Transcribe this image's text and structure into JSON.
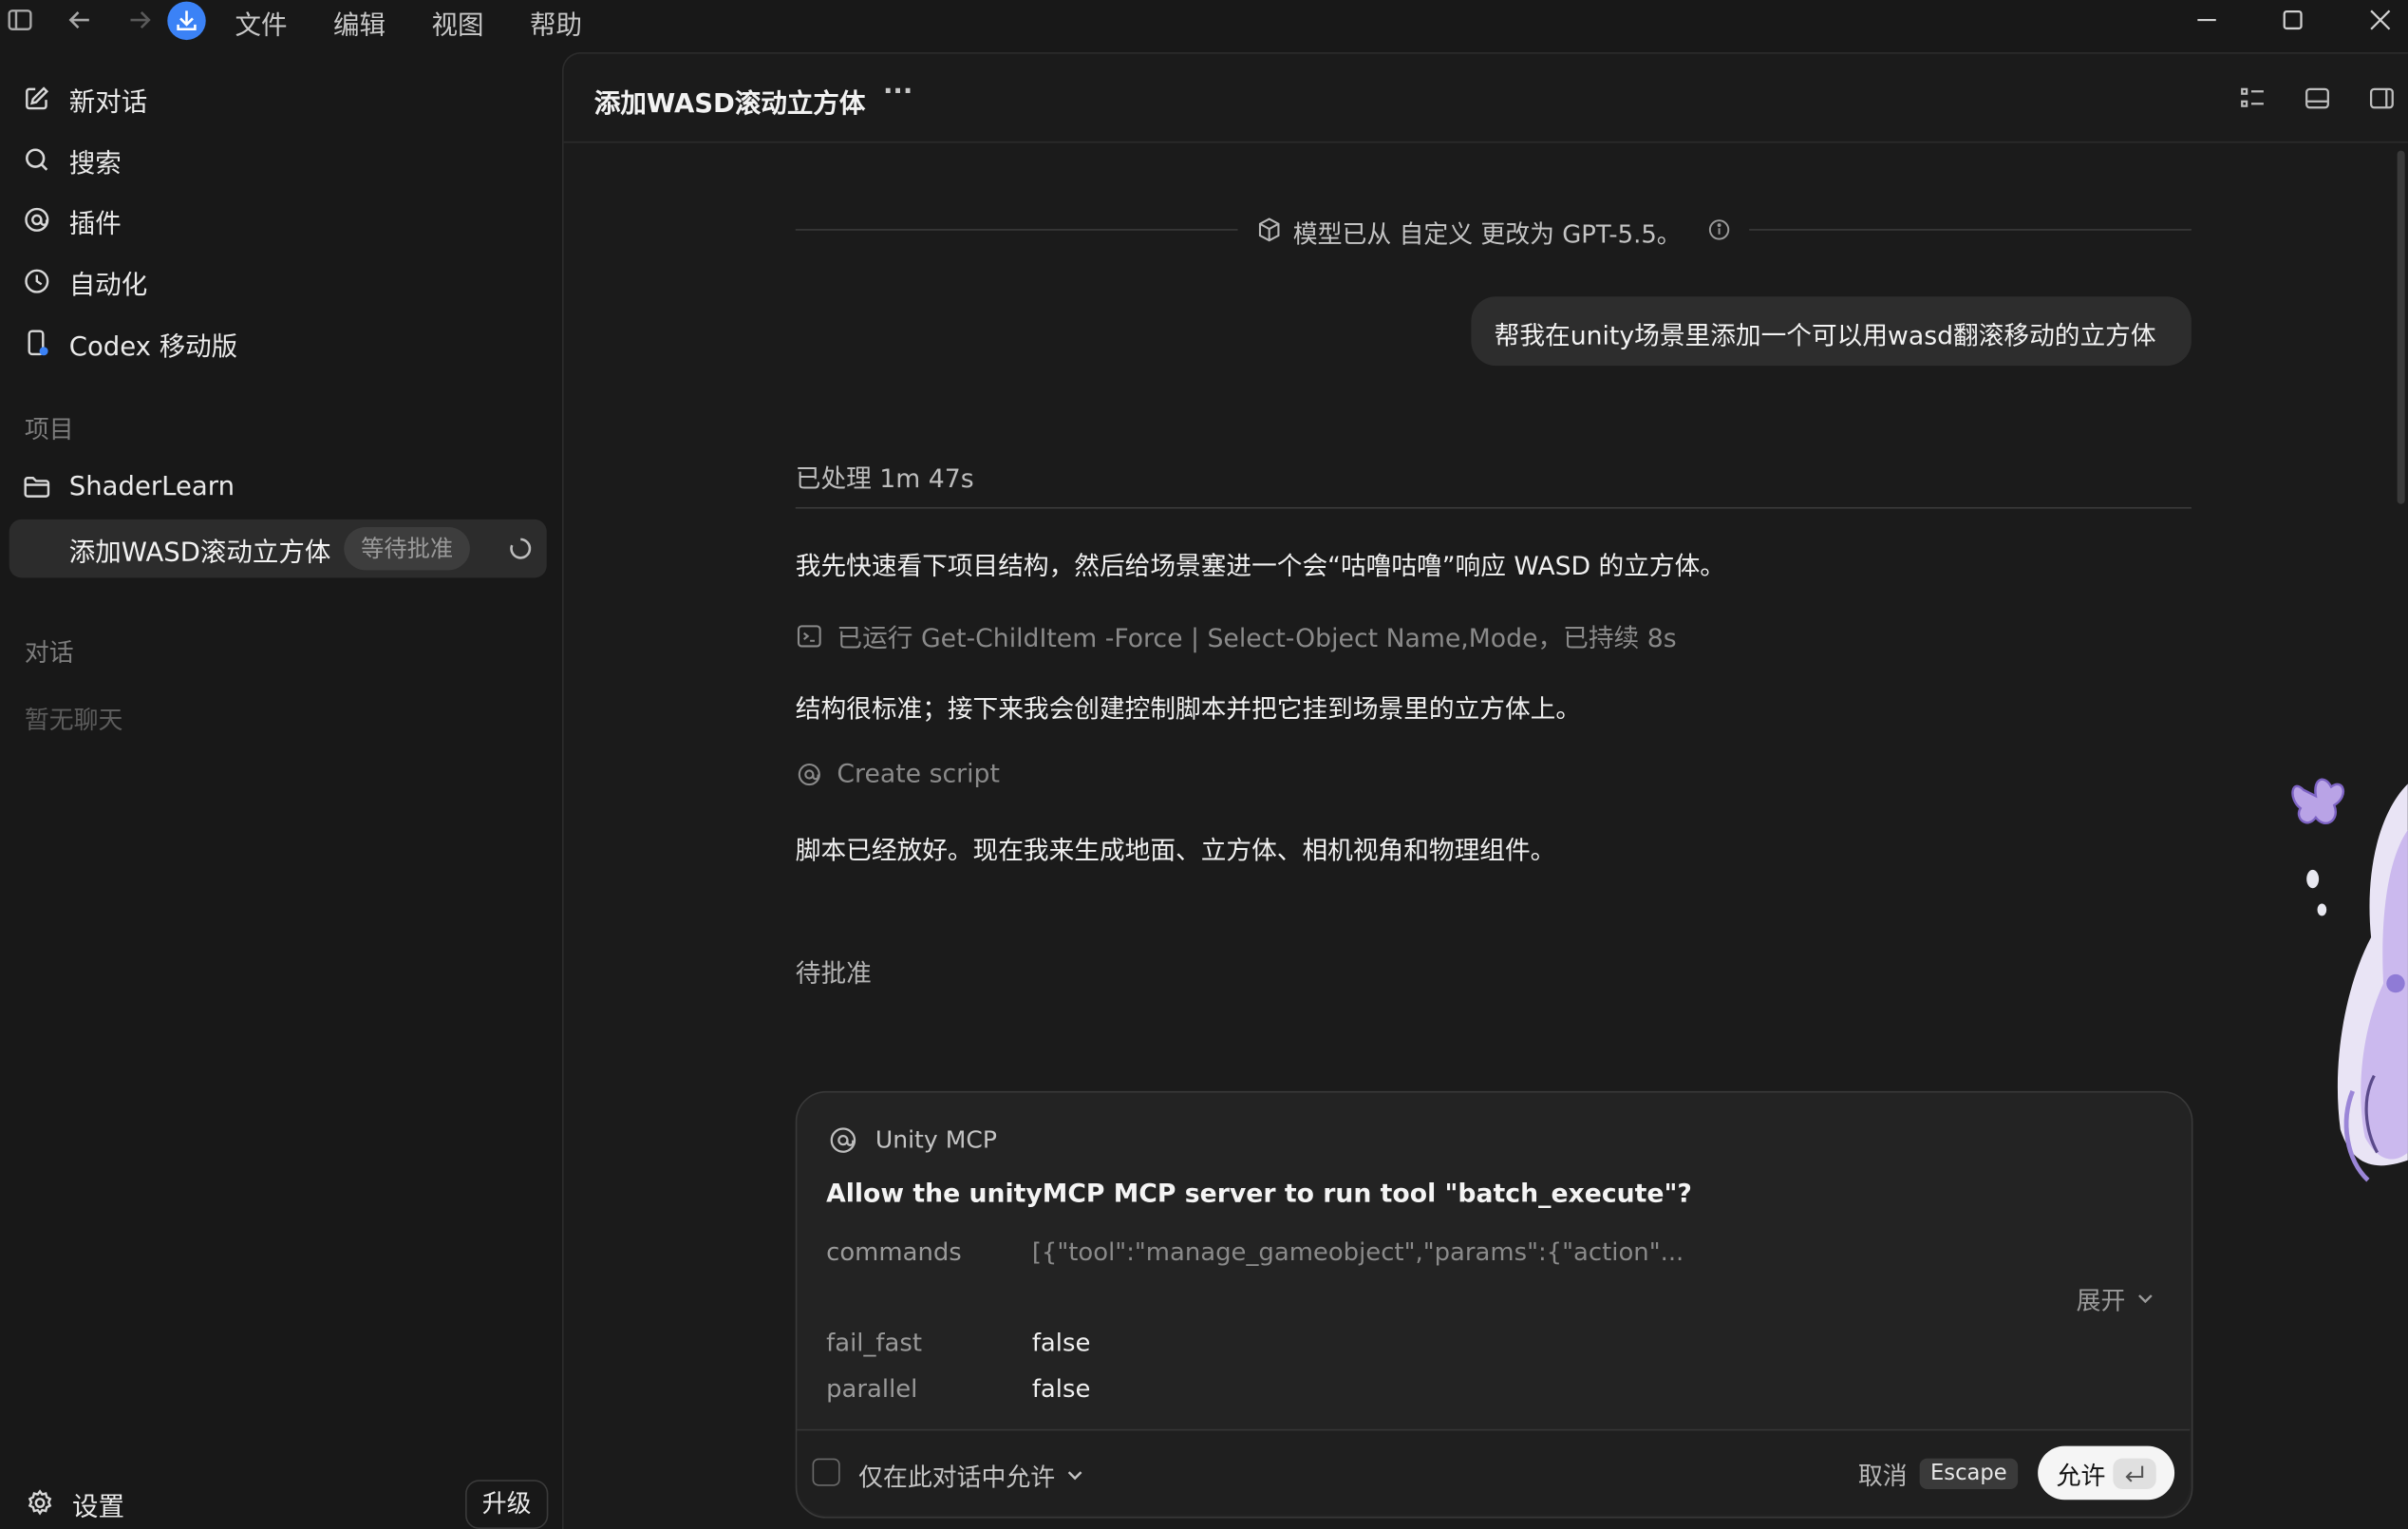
{
  "menu": [
    "文件",
    "编辑",
    "视图",
    "帮助"
  ],
  "sidebar": {
    "nav": [
      {
        "label": "新对话",
        "icon": "edit-icon"
      },
      {
        "label": "搜索",
        "icon": "search-icon"
      },
      {
        "label": "插件",
        "icon": "plugin-icon"
      },
      {
        "label": "自动化",
        "icon": "clock-icon"
      },
      {
        "label": "Codex 移动版",
        "icon": "mobile-icon"
      }
    ],
    "projects_label": "项目",
    "project_name": "ShaderLearn",
    "active_thread": {
      "title": "添加WASD滚动立方体",
      "badge": "等待批准"
    },
    "chats_label": "对话",
    "no_chats": "暂无聊天",
    "settings_label": "设置",
    "upgrade_label": "升级"
  },
  "header": {
    "title": "添加WASD滚动立方体",
    "more": "···"
  },
  "conversation": {
    "model_notice": "模型已从 自定义 更改为 GPT-5.5。",
    "user_message": "帮我在unity场景里添加一个可以用wasd翻滚移动的立方体",
    "processed": "已处理 1m 47s",
    "msg1": "我先快速看下项目结构，然后给场景塞进一个会“咕噜咕噜”响应 WASD 的立方体。",
    "cmd_run": "已运行 Get-ChildItem -Force | Select-Object Name,Mode，已持续 8s",
    "msg2": "结构很标准；接下来我会创建控制脚本并把它挂到场景里的立方体上。",
    "tool_call": "Create script",
    "msg3": "脚本已经放好。现在我来生成地面、立方体、相机视角和物理组件。",
    "pending": "待批准"
  },
  "approval": {
    "server": "Unity MCP",
    "question": "Allow the unityMCP MCP server to run tool \"batch_execute\"?",
    "params": [
      {
        "key": "commands",
        "value": "[{\"tool\":\"manage_gameobject\",\"params\":{\"action\"..."
      },
      {
        "key": "fail_fast",
        "value": "false"
      },
      {
        "key": "parallel",
        "value": "false"
      }
    ],
    "expand_label": "展开",
    "allow_in_chat_label": "仅在此对话中允许",
    "cancel_label": "取消",
    "cancel_key": "Escape",
    "allow_label": "允许"
  },
  "colors": {
    "background": "#181818",
    "panel": "#1b1b1b",
    "accent_blue": "#3b82f6"
  }
}
